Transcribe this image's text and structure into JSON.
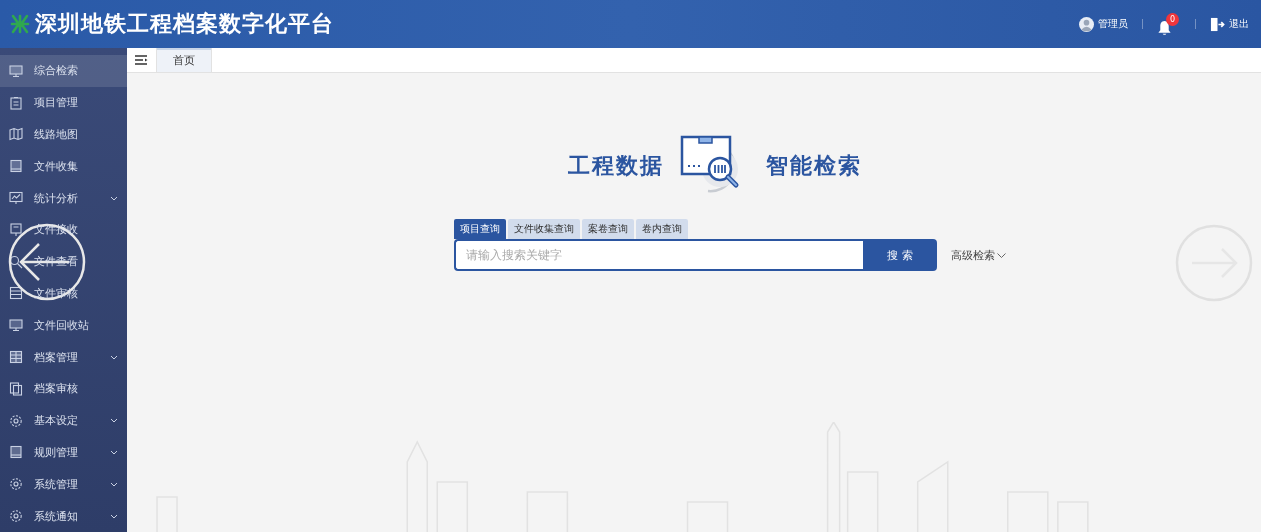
{
  "header": {
    "title": "深圳地铁工程档案数字化平台",
    "user": "管理员",
    "notification_count": "0",
    "logout": "退出"
  },
  "sidebar": {
    "items": [
      {
        "label": "综合检索",
        "submenu": false,
        "selected": true
      },
      {
        "label": "项目管理",
        "submenu": false,
        "selected": false
      },
      {
        "label": "线路地图",
        "submenu": false,
        "selected": false
      },
      {
        "label": "文件收集",
        "submenu": false,
        "selected": false
      },
      {
        "label": "统计分析",
        "submenu": true,
        "selected": false
      },
      {
        "label": "文件接收",
        "submenu": false,
        "selected": false
      },
      {
        "label": "文件查看",
        "submenu": false,
        "selected": false
      },
      {
        "label": "文件审核",
        "submenu": false,
        "selected": false
      },
      {
        "label": "文件回收站",
        "submenu": false,
        "selected": false
      },
      {
        "label": "档案管理",
        "submenu": true,
        "selected": false
      },
      {
        "label": "档案审核",
        "submenu": false,
        "selected": false
      },
      {
        "label": "基本设定",
        "submenu": true,
        "selected": false
      },
      {
        "label": "规则管理",
        "submenu": true,
        "selected": false
      },
      {
        "label": "系统管理",
        "submenu": true,
        "selected": false
      },
      {
        "label": "系统通知",
        "submenu": true,
        "selected": false
      }
    ]
  },
  "page_tabs": [
    {
      "label": "首页",
      "selected": true
    }
  ],
  "hero": {
    "left": "工程数据",
    "right": "智能检索"
  },
  "search": {
    "tabs": [
      {
        "label": "项目查询",
        "selected": true
      },
      {
        "label": "文件收集查询",
        "selected": false
      },
      {
        "label": "案卷查询",
        "selected": false
      },
      {
        "label": "卷内查询",
        "selected": false
      }
    ],
    "placeholder": "请输入搜索关键字",
    "button": "搜 索",
    "advanced": "高级检索"
  }
}
